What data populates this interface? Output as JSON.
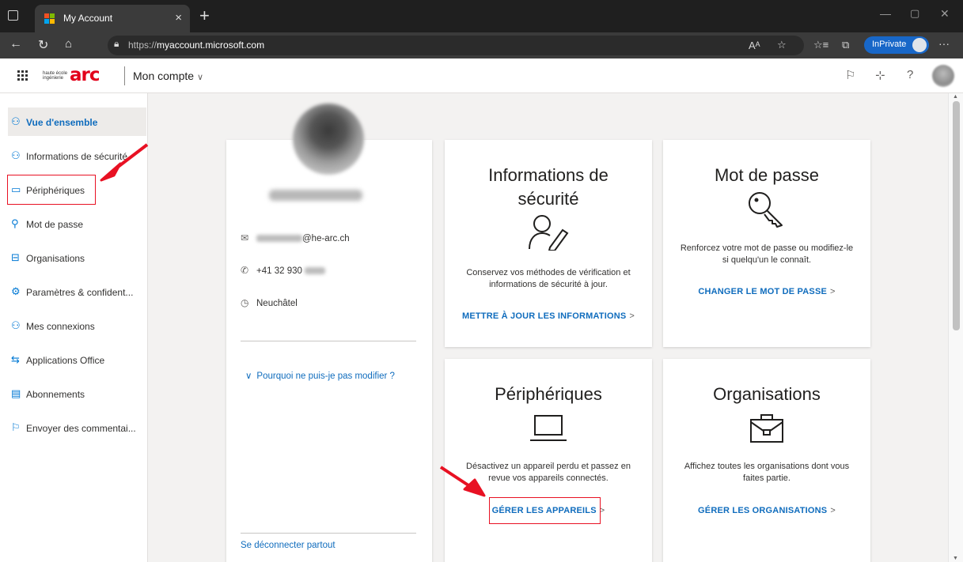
{
  "browser": {
    "tab_title": "My Account",
    "tab_close": "×",
    "new_tab": "+",
    "url_prefix": "https://",
    "url_host": "myaccount.microsoft.com",
    "inprivate_label": "InPrivate",
    "more": "···"
  },
  "header": {
    "logo_small": "haute école ingénierie",
    "logo_text": "arc",
    "app_title": "Mon compte",
    "chevron": "∨",
    "help": "?"
  },
  "sidebar": {
    "items": [
      {
        "label": "Vue d'ensemble",
        "icon": "person-icon"
      },
      {
        "label": "Informations de sécurité",
        "icon": "security-info-icon"
      },
      {
        "label": "Périphériques",
        "icon": "laptop-icon"
      },
      {
        "label": "Mot de passe",
        "icon": "key-icon"
      },
      {
        "label": "Organisations",
        "icon": "briefcase-icon"
      },
      {
        "label": "Paramètres & confident...",
        "icon": "gear-icon"
      },
      {
        "label": "Mes connexions",
        "icon": "sign-in-icon"
      },
      {
        "label": "Applications Office",
        "icon": "office-apps-icon"
      },
      {
        "label": "Abonnements",
        "icon": "subscriptions-icon"
      },
      {
        "label": "Envoyer des commentai...",
        "icon": "feedback-icon"
      }
    ]
  },
  "profile": {
    "email_domain": "@he-arc.ch",
    "phone_prefix": "+41 32 930",
    "location": "Neuchâtel",
    "why_link": "Pourquoi ne puis-je pas modifier ?",
    "logout": "Se déconnecter partout"
  },
  "tiles": {
    "security": {
      "title_line1": "Informations de",
      "title_line2": "sécurité",
      "desc_line1": "Conservez vos méthodes de vérification et",
      "desc_line2": "informations de sécurité à jour.",
      "link": "METTRE À JOUR LES INFORMATIONS"
    },
    "password": {
      "title": "Mot de passe",
      "desc_line1": "Renforcez votre mot de passe ou modifiez-le",
      "desc_line2": "si quelqu'un le connaît.",
      "link": "CHANGER LE MOT DE PASSE"
    },
    "devices": {
      "title": "Périphériques",
      "desc_line1": "Désactivez un appareil perdu et passez en",
      "desc_line2": "revue vos appareils connectés.",
      "link": "GÉRER LES APPAREILS"
    },
    "organisations": {
      "title": "Organisations",
      "desc_line1": "Affichez toutes les organisations dont vous",
      "desc_line2": "faites partie.",
      "link": "GÉRER LES ORGANISATIONS"
    },
    "link_chevron": ">"
  },
  "colors": {
    "accent": "#0f6cbd",
    "annotation_red": "#e81123",
    "brand_red": "#e2001a"
  }
}
